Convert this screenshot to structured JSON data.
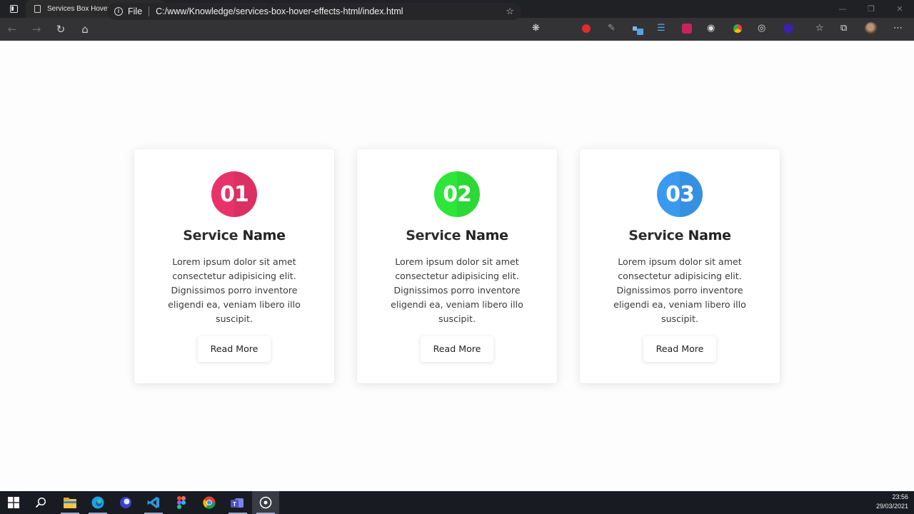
{
  "browser": {
    "tab_title": "Services Box Hover Effects",
    "tab_close": "✕",
    "new_tab": "+",
    "file_label": "File",
    "url": "C:/www/Knowledge/services-box-hover-effects-html/index.html"
  },
  "services": [
    {
      "number": "01",
      "title_light": "Service",
      "title_bold": "Name",
      "description": "Lorem ipsum dolor sit amet consectetur adipisicing elit. Dignissimos porro inventore eligendi ea, veniam libero illo suscipit.",
      "button": "Read More",
      "color": "#e8336a"
    },
    {
      "number": "02",
      "title_light": "Service",
      "title_bold": "Name",
      "description": "Lorem ipsum dolor sit amet consectetur adipisicing elit. Dignissimos porro inventore eligendi ea, veniam libero illo suscipit.",
      "button": "Read More",
      "color": "#2ee63a"
    },
    {
      "number": "03",
      "title_light": "Service",
      "title_bold": "Name",
      "description": "Lorem ipsum dolor sit amet consectetur adipisicing elit. Dignissimos porro inventore eligendi ea, veniam libero illo suscipit.",
      "button": "Read More",
      "color": "#3a9af0"
    }
  ],
  "taskbar": {
    "time": "23:56",
    "date": "29/03/2021"
  }
}
